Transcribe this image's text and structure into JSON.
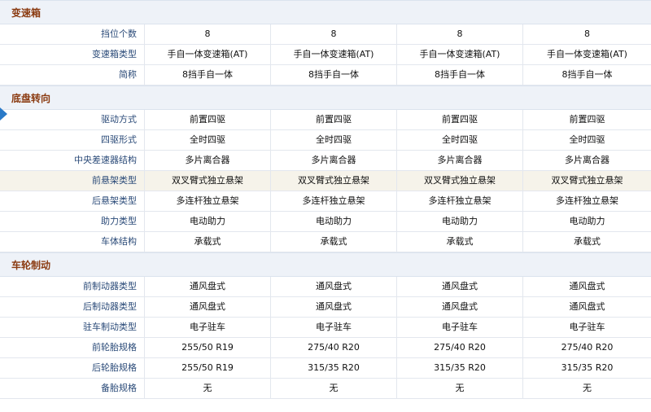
{
  "sections": [
    {
      "title": "变速箱",
      "rows": [
        {
          "label": "挡位个数",
          "values": [
            "8",
            "8",
            "8",
            "8"
          ],
          "highlight": false
        },
        {
          "label": "变速箱类型",
          "values": [
            "手自一体变速箱(AT)",
            "手自一体变速箱(AT)",
            "手自一体变速箱(AT)",
            "手自一体变速箱(AT)"
          ],
          "highlight": false
        },
        {
          "label": "简称",
          "values": [
            "8挡手自一体",
            "8挡手自一体",
            "8挡手自一体",
            "8挡手自一体"
          ],
          "highlight": false
        }
      ]
    },
    {
      "title": "底盘转向",
      "rows": [
        {
          "label": "驱动方式",
          "values": [
            "前置四驱",
            "前置四驱",
            "前置四驱",
            "前置四驱"
          ],
          "highlight": false
        },
        {
          "label": "四驱形式",
          "values": [
            "全时四驱",
            "全时四驱",
            "全时四驱",
            "全时四驱"
          ],
          "highlight": false
        },
        {
          "label": "中央差速器结构",
          "values": [
            "多片离合器",
            "多片离合器",
            "多片离合器",
            "多片离合器"
          ],
          "highlight": false
        },
        {
          "label": "前悬架类型",
          "values": [
            "双叉臂式独立悬架",
            "双叉臂式独立悬架",
            "双叉臂式独立悬架",
            "双叉臂式独立悬架"
          ],
          "highlight": true
        },
        {
          "label": "后悬架类型",
          "values": [
            "多连杆独立悬架",
            "多连杆独立悬架",
            "多连杆独立悬架",
            "多连杆独立悬架"
          ],
          "highlight": false
        },
        {
          "label": "助力类型",
          "values": [
            "电动助力",
            "电动助力",
            "电动助力",
            "电动助力"
          ],
          "highlight": false
        },
        {
          "label": "车体结构",
          "values": [
            "承载式",
            "承载式",
            "承载式",
            "承载式"
          ],
          "highlight": false
        }
      ]
    },
    {
      "title": "车轮制动",
      "rows": [
        {
          "label": "前制动器类型",
          "values": [
            "通风盘式",
            "通风盘式",
            "通风盘式",
            "通风盘式"
          ],
          "highlight": false
        },
        {
          "label": "后制动器类型",
          "values": [
            "通风盘式",
            "通风盘式",
            "通风盘式",
            "通风盘式"
          ],
          "highlight": false
        },
        {
          "label": "驻车制动类型",
          "values": [
            "电子驻车",
            "电子驻车",
            "电子驻车",
            "电子驻车"
          ],
          "highlight": false
        },
        {
          "label": "前轮胎规格",
          "values": [
            "255/50 R19",
            "275/40 R20",
            "275/40 R20",
            "275/40 R20"
          ],
          "highlight": false
        },
        {
          "label": "后轮胎规格",
          "values": [
            "255/50 R19",
            "315/35 R20",
            "315/35 R20",
            "315/35 R20"
          ],
          "highlight": false
        },
        {
          "label": "备胎规格",
          "values": [
            "无",
            "无",
            "无",
            "无"
          ],
          "highlight": false
        }
      ]
    }
  ],
  "colors": {
    "section_bg": "#eef2f8",
    "section_title": "#8a3a10",
    "label_text": "#2a4a78",
    "highlight_row": "#f6f3ea",
    "arrow": "#2a7ac8"
  },
  "icons": {
    "active_marker": "triangle-right-icon"
  }
}
